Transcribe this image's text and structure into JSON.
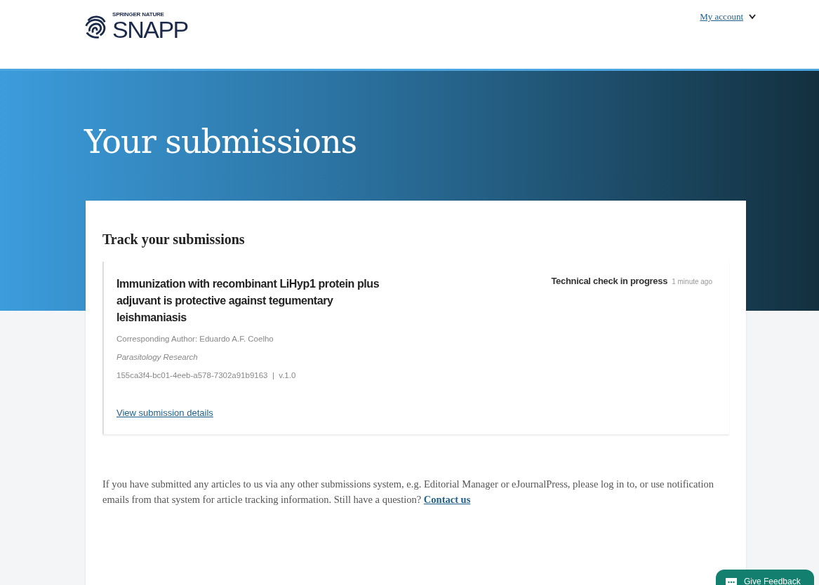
{
  "header": {
    "logo_small": "SPRINGER NATURE",
    "logo": "SNAPP",
    "account_menu": "My account"
  },
  "hero": {
    "title": "Your submissions"
  },
  "card": {
    "heading": "Track your submissions",
    "submissions": [
      {
        "title": "Immunization with recombinant LiHyp1 protein plus adjuvant is protective against tegumentary leishmaniasis",
        "author": "Corresponding Author: Eduardo A.F. Coelho",
        "journal": "Parasitology Research",
        "id_version": "155ca3f4-bc01-4eeb-a578-7302a91b9163  |  v.1.0",
        "status": "Technical check in progress",
        "time": "1 minute ago",
        "link": "View submission details"
      }
    ],
    "note": "If you have submitted any articles to us via any other submissions system, e.g. Editorial Manager or eJournalPress, please log in to, or use notification emails from that system for article tracking information. Still have a question?",
    "note_link": "Contact us"
  },
  "feedback_button": "Give Feedback"
}
